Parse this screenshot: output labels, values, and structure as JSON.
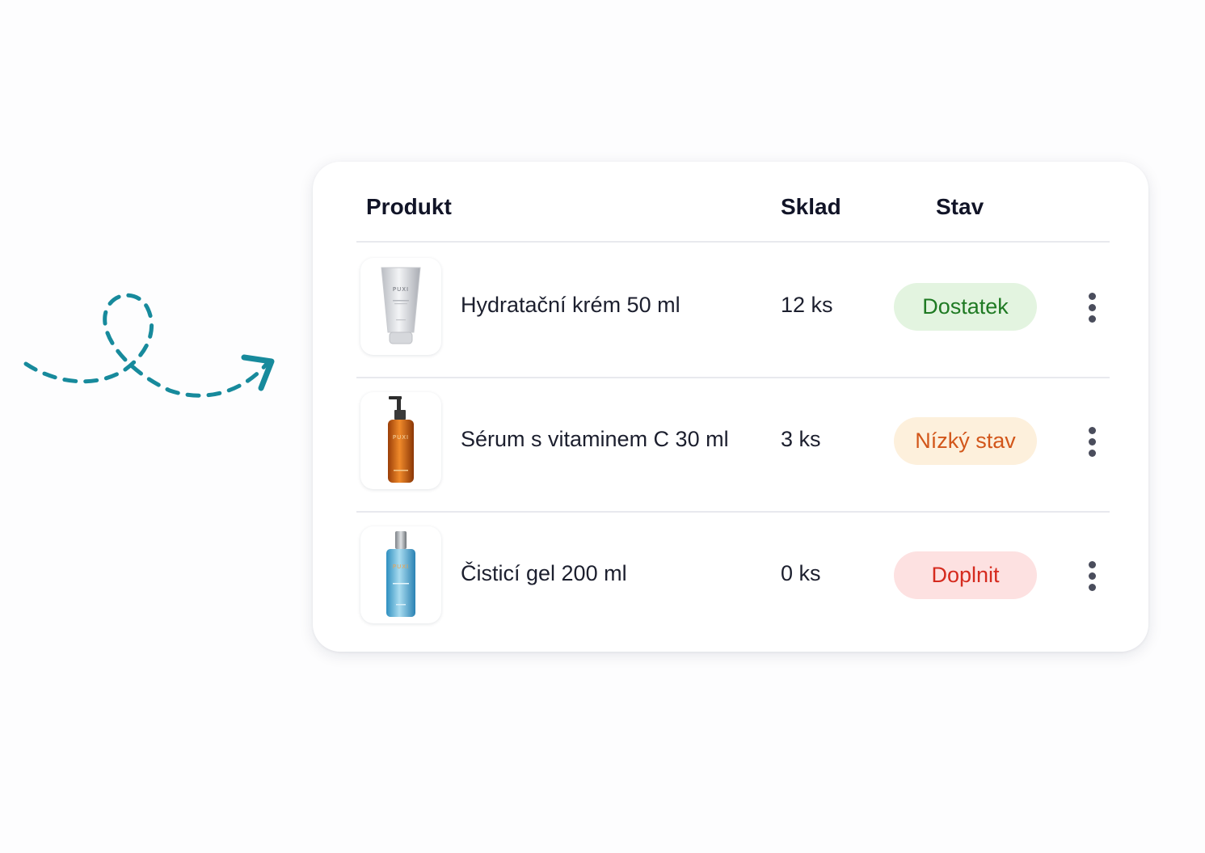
{
  "table": {
    "columns": {
      "product": "Produkt",
      "stock": "Sklad",
      "status": "Stav"
    },
    "rows": [
      {
        "name": "Hydratační krém 50 ml",
        "stock": "12 ks",
        "status": "Dostatek",
        "status_color": "#1f7a23",
        "status_bg": "#e3f4e0",
        "image": "cream-tube-icon",
        "brand": "PUXI"
      },
      {
        "name": "Sérum s vitaminem C 30 ml",
        "stock": "3 ks",
        "status": "Nízký stav",
        "status_color": "#d2561a",
        "status_bg": "#fdf0dc",
        "image": "serum-pump-bottle-icon",
        "brand": "PUXI"
      },
      {
        "name": "Čisticí gel 200 ml",
        "stock": "0 ks",
        "status": "Doplnit",
        "status_color": "#d52a1e",
        "status_bg": "#fde1e1",
        "image": "cleansing-gel-bottle-icon",
        "brand": "PUXI"
      }
    ]
  },
  "colors": {
    "doodle": "#178a9c"
  }
}
